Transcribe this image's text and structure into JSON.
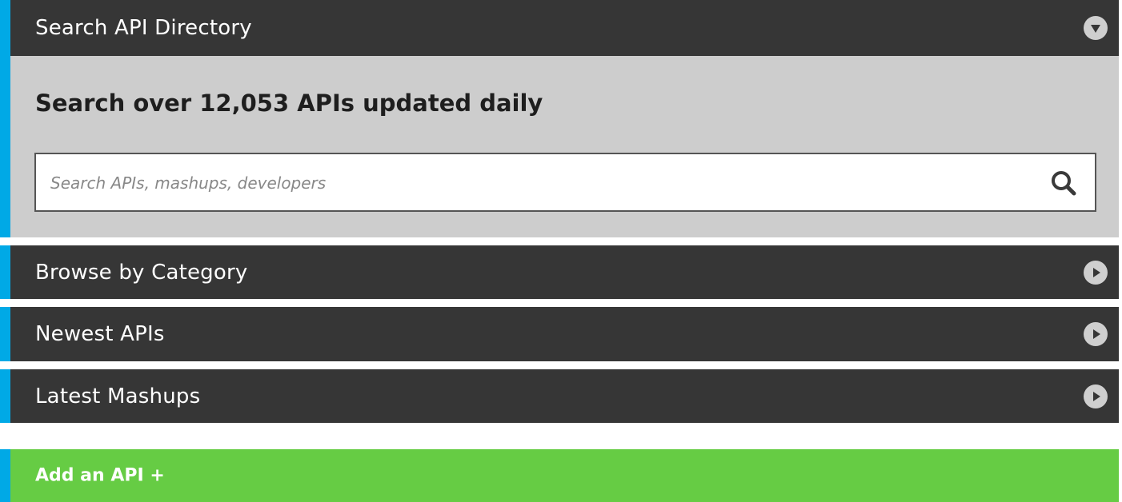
{
  "panels": {
    "search": {
      "title": "Search API Directory",
      "toggle_icon": "chevron-down-circle-icon"
    },
    "browse": {
      "title": "Browse by Category",
      "toggle_icon": "chevron-right-circle-icon"
    },
    "newest": {
      "title": "Newest APIs",
      "toggle_icon": "chevron-right-circle-icon"
    },
    "mashups": {
      "title": "Latest Mashups",
      "toggle_icon": "chevron-right-circle-icon"
    }
  },
  "search": {
    "heading": "Search over 12,053 APIs updated daily",
    "placeholder": "Search APIs, mashups, developers",
    "value": "",
    "icon": "magnifier-icon"
  },
  "add_api": {
    "label": "Add an API +"
  },
  "colors": {
    "header_bg": "#363636",
    "accent_stripe": "#00a9e6",
    "search_body_bg": "#cdcdcd",
    "add_button_bg": "#66cc44",
    "toggle_circle": "#cfcfcf"
  }
}
